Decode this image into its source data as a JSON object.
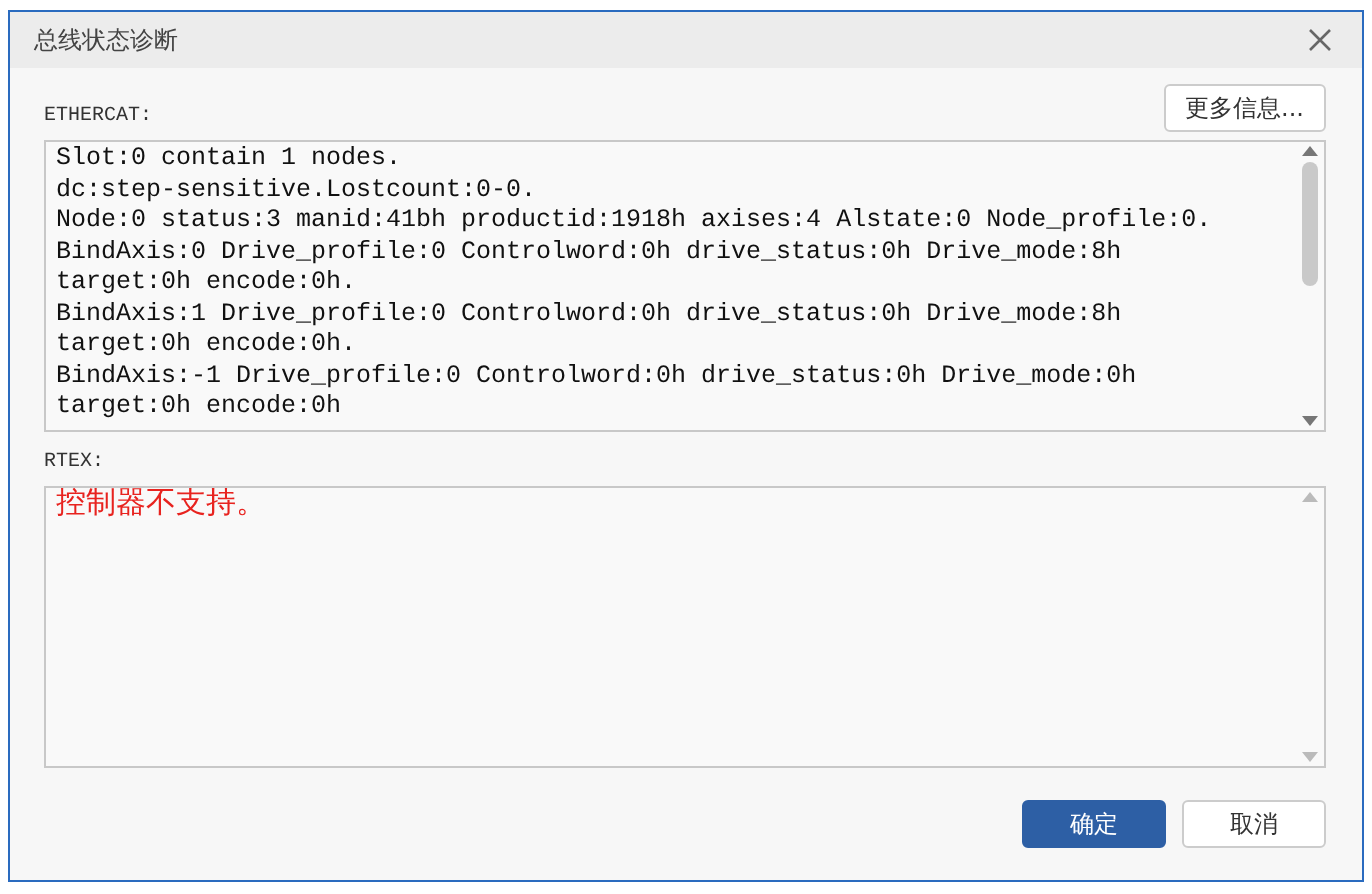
{
  "window": {
    "title": "总线状态诊断"
  },
  "ethercat": {
    "label": "ETHERCAT:",
    "more_button": "更多信息...",
    "lines": [
      "Slot:0 contain 1 nodes.",
      "dc:step-sensitive.Lostcount:0-0.",
      "Node:0 status:3 manid:41bh productid:1918h axises:4 Alstate:0 Node_profile:0.",
      "BindAxis:0 Drive_profile:0 Controlword:0h drive_status:0h Drive_mode:8h",
      "target:0h encode:0h.",
      "BindAxis:1 Drive_profile:0 Controlword:0h drive_status:0h Drive_mode:8h",
      "target:0h encode:0h.",
      "BindAxis:-1 Drive_profile:0 Controlword:0h drive_status:0h Drive_mode:0h",
      "target:0h encode:0h"
    ]
  },
  "rtex": {
    "label": "RTEX:",
    "message": "控制器不支持。"
  },
  "buttons": [
    {
      "label": "确定",
      "kind": "primary"
    },
    {
      "label": "取消",
      "kind": "secondary"
    }
  ]
}
